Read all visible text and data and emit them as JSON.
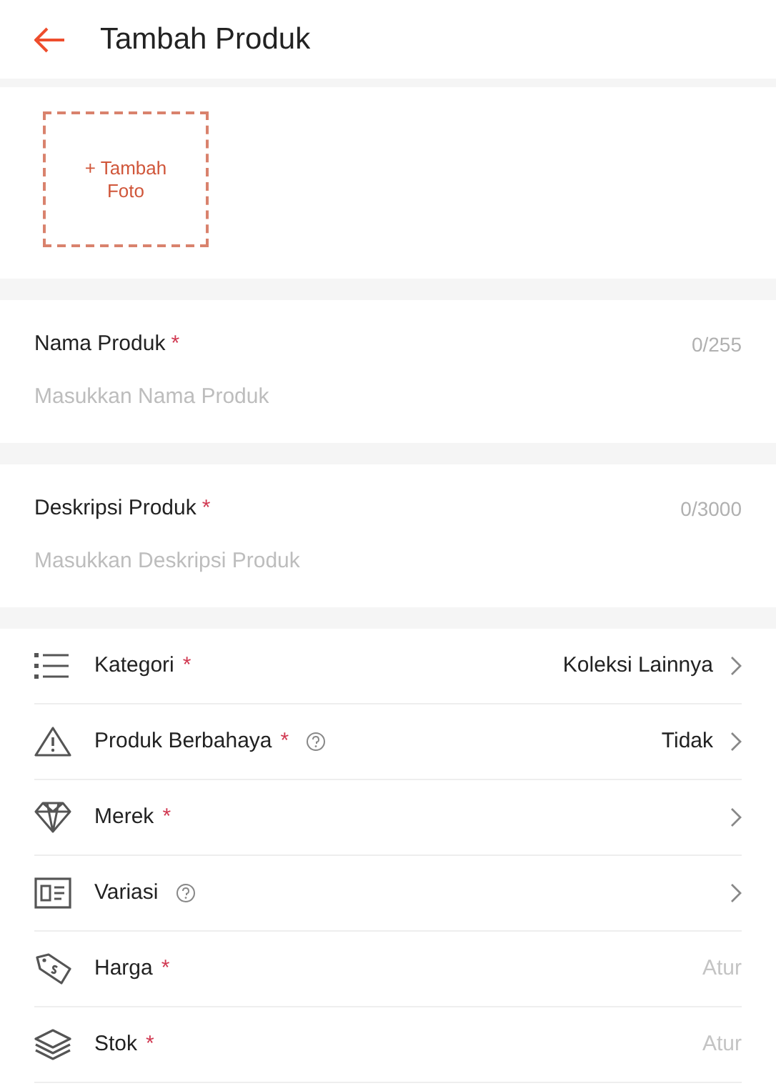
{
  "header": {
    "title": "Tambah Produk"
  },
  "photo_upload": {
    "label": "+ Tambah Foto"
  },
  "fields": [
    {
      "label": "Nama Produk",
      "asterisk": "*",
      "counter": "0/255",
      "placeholder": "Masukkan Nama Produk"
    },
    {
      "label": "Deskripsi Produk",
      "asterisk": "*",
      "counter": "0/3000",
      "placeholder": "Masukkan Deskripsi Produk"
    }
  ],
  "settings": [
    {
      "label": "Kategori",
      "asterisk": "*",
      "help": false,
      "kind": "select",
      "value": "Koleksi Lainnya"
    },
    {
      "label": "Produk Berbahaya",
      "asterisk": "*",
      "help": true,
      "kind": "select",
      "value": "Tidak"
    },
    {
      "label": "Merek",
      "asterisk": "*",
      "help": false,
      "kind": "select"
    },
    {
      "label": "Variasi",
      "help": true,
      "kind": "select"
    },
    {
      "label": "Harga",
      "asterisk": "*",
      "help": false,
      "kind": "input",
      "value": "Atur"
    },
    {
      "label": "Stok",
      "asterisk": "*",
      "help": false,
      "kind": "input",
      "value": "Atur"
    }
  ]
}
